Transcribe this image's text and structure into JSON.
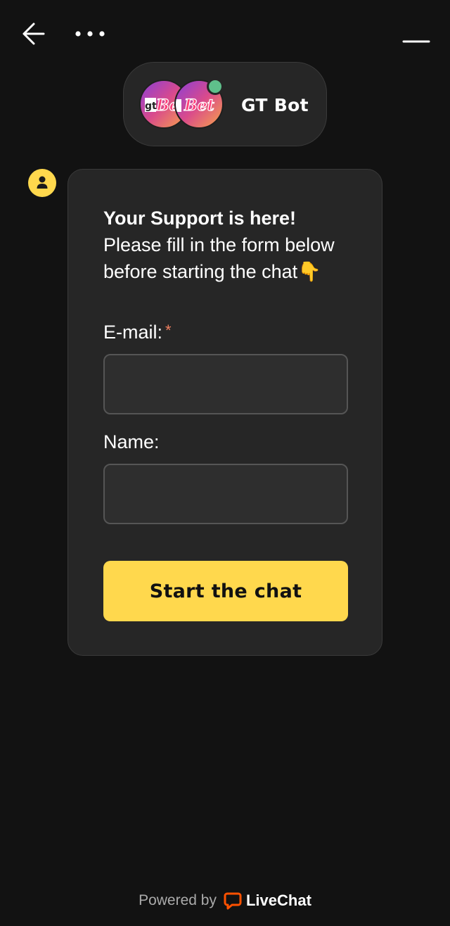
{
  "header": {
    "back_icon": "arrow-left-icon",
    "menu_icon": "more-horizontal-icon",
    "minimize_icon": "minimize-icon",
    "agent_name": "GT Bot",
    "avatar_text": "Bet",
    "status_color": "#5fc08b"
  },
  "message": {
    "avatar_icon": "user-icon",
    "title": "Your Support is here!",
    "body": "Please fill in the form below before starting the chat👇",
    "form": {
      "email_label": "E-mail:",
      "email_required_mark": "*",
      "email_value": "",
      "name_label": "Name:",
      "name_value": "",
      "submit_label": "Start the chat"
    }
  },
  "footer": {
    "powered_by": "Powered by",
    "brand": "LiveChat",
    "brand_color": "#ff5100"
  },
  "colors": {
    "background": "#121212",
    "card": "#262626",
    "accent": "#ffd84d",
    "required": "#f08060"
  }
}
